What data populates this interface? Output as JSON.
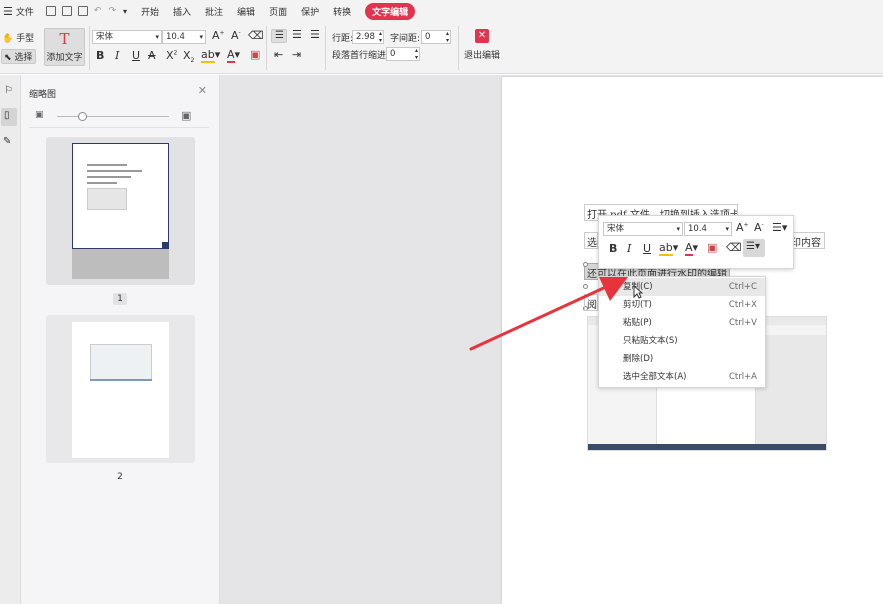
{
  "menu": {
    "file": "文件",
    "tabs": [
      "开始",
      "插入",
      "批注",
      "编辑",
      "页面",
      "保护",
      "转换",
      "文字编辑"
    ]
  },
  "toolbar": {
    "hand": "手型",
    "select": "选择",
    "add_text": "添加文字",
    "font": "宋体",
    "size": "10.4",
    "line_spacing_label": "行距:",
    "line_spacing": "2.98",
    "char_spacing_label": "字间距:",
    "char_spacing": "0",
    "indent_label": "段落首行缩进:",
    "indent": "0",
    "exit_edit": "退出编辑"
  },
  "panel": {
    "title": "缩略图",
    "pages": [
      "1",
      "2"
    ]
  },
  "doc": {
    "line1": "打开 pdf 文件，切换到插入选项卡",
    "line2_left": "选",
    "line2_right": "印内容",
    "line3": "还可以在此页面进行水印的编辑",
    "line4": "阅"
  },
  "mini_toolbar": {
    "font": "宋体",
    "size": "10.4"
  },
  "context_menu": [
    {
      "label": "复制(C)",
      "shortcut": "Ctrl+C"
    },
    {
      "label": "剪切(T)",
      "shortcut": "Ctrl+X"
    },
    {
      "label": "粘贴(P)",
      "shortcut": "Ctrl+V"
    },
    {
      "label": "只粘贴文本(S)",
      "shortcut": ""
    },
    {
      "label": "删除(D)",
      "shortcut": ""
    },
    {
      "label": "选中全部文本(A)",
      "shortcut": "Ctrl+A"
    }
  ],
  "colors": {
    "accent": "#e2344e",
    "arrow": "#e8333d"
  }
}
